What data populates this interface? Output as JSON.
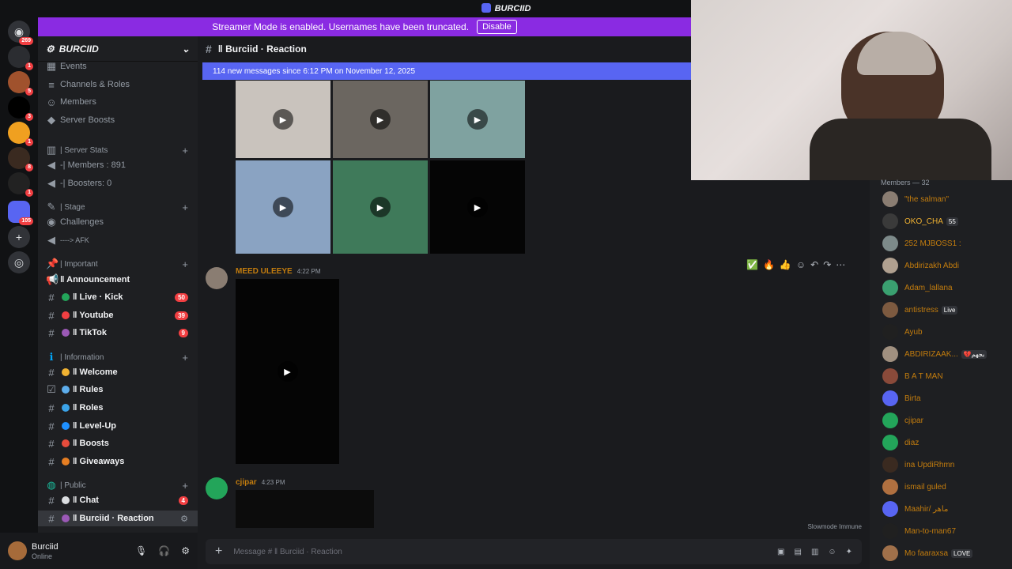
{
  "window": {
    "title": "BURCIID"
  },
  "banner": {
    "text": "Streamer Mode is enabled. Usernames have been truncated.",
    "button": "Disable"
  },
  "guilds": [
    {
      "badge": "269"
    },
    {
      "badge": "1"
    },
    {
      "badge": "5"
    },
    {
      "badge": "3"
    },
    {
      "badge": "1"
    },
    {
      "badge": "8"
    },
    {
      "badge": "1"
    },
    {
      "badge": "105"
    }
  ],
  "server": {
    "name": "BURCIID"
  },
  "sidebar": {
    "top": [
      "Events",
      "Channels & Roles",
      "Members",
      "Server Boosts"
    ],
    "cat_stats": "| Server Stats",
    "stats": [
      "-| Members : 891",
      "-| Boosters: 0"
    ],
    "cat_stage": "| Stage",
    "stage": [
      "Challenges",
      "----> AFK"
    ],
    "cat_important": "| Important",
    "important": [
      {
        "label": "‖ Announcement",
        "badge": ""
      },
      {
        "label": "‖ Live · Kick",
        "badge": "50"
      },
      {
        "label": "‖ Youtube",
        "badge": "39"
      },
      {
        "label": "‖ TikTok",
        "badge": "9"
      }
    ],
    "cat_info": "| Information",
    "info": [
      {
        "label": "‖ Welcome"
      },
      {
        "label": "‖ Rules"
      },
      {
        "label": "‖ Roles"
      },
      {
        "label": "‖ Level-Up"
      },
      {
        "label": "‖ Boosts"
      },
      {
        "label": "‖ Giveaways"
      }
    ],
    "cat_public": "| Public",
    "public": [
      {
        "label": "‖ Chat",
        "badge": "4"
      },
      {
        "label": "‖ Burciid · Reaction",
        "badge": ""
      }
    ]
  },
  "user": {
    "name": "Burciid",
    "status": "Online"
  },
  "channel": {
    "name": "‖ Burciid · Reaction",
    "new_messages": "114 new messages since 6:12 PM on November 12, 2025",
    "compose_placeholder": "Message # ‖ Burciid · Reaction",
    "slowmode": "Slowmode Immune"
  },
  "messages": [
    {
      "author": "MEED ULEEYE",
      "time": "4:22 PM",
      "color": "#c27c0e"
    },
    {
      "author": "cjipar",
      "time": "4:23 PM",
      "color": "#c27c0e"
    }
  ],
  "members": {
    "header": "Members — 32",
    "list": [
      {
        "name": "\"the salman\"",
        "color": "#c27c0e",
        "tag": ""
      },
      {
        "name": "OKO_CHA",
        "color": "#f0b232",
        "tag": "55"
      },
      {
        "name": "252 MJBOSS1 :",
        "color": "#c27c0e",
        "tag": ""
      },
      {
        "name": "Abdirizakh Abdi",
        "color": "#c27c0e",
        "tag": ""
      },
      {
        "name": "Adam_lallana",
        "color": "#c27c0e",
        "tag": ""
      },
      {
        "name": "antistress",
        "color": "#c27c0e",
        "tag": "Live"
      },
      {
        "name": "Ayub",
        "color": "#c27c0e",
        "tag": ""
      },
      {
        "name": "ABDIRIZAAK...",
        "color": "#c27c0e",
        "tag": "💔بجهم"
      },
      {
        "name": "B A T MAN",
        "color": "#c27c0e",
        "tag": ""
      },
      {
        "name": "Birta",
        "color": "#c27c0e",
        "tag": ""
      },
      {
        "name": "cjipar",
        "color": "#c27c0e",
        "tag": ""
      },
      {
        "name": "diaz",
        "color": "#c27c0e",
        "tag": ""
      },
      {
        "name": "ina UpdiRhmn",
        "color": "#c27c0e",
        "tag": ""
      },
      {
        "name": "ismail guled",
        "color": "#c27c0e",
        "tag": ""
      },
      {
        "name": "Maahir/ ماهر",
        "color": "#c27c0e",
        "tag": ""
      },
      {
        "name": "Man-to-man67",
        "color": "#c27c0e",
        "tag": ""
      },
      {
        "name": "Mo faaraxsa",
        "color": "#c27c0e",
        "tag": "LOVE"
      }
    ]
  }
}
